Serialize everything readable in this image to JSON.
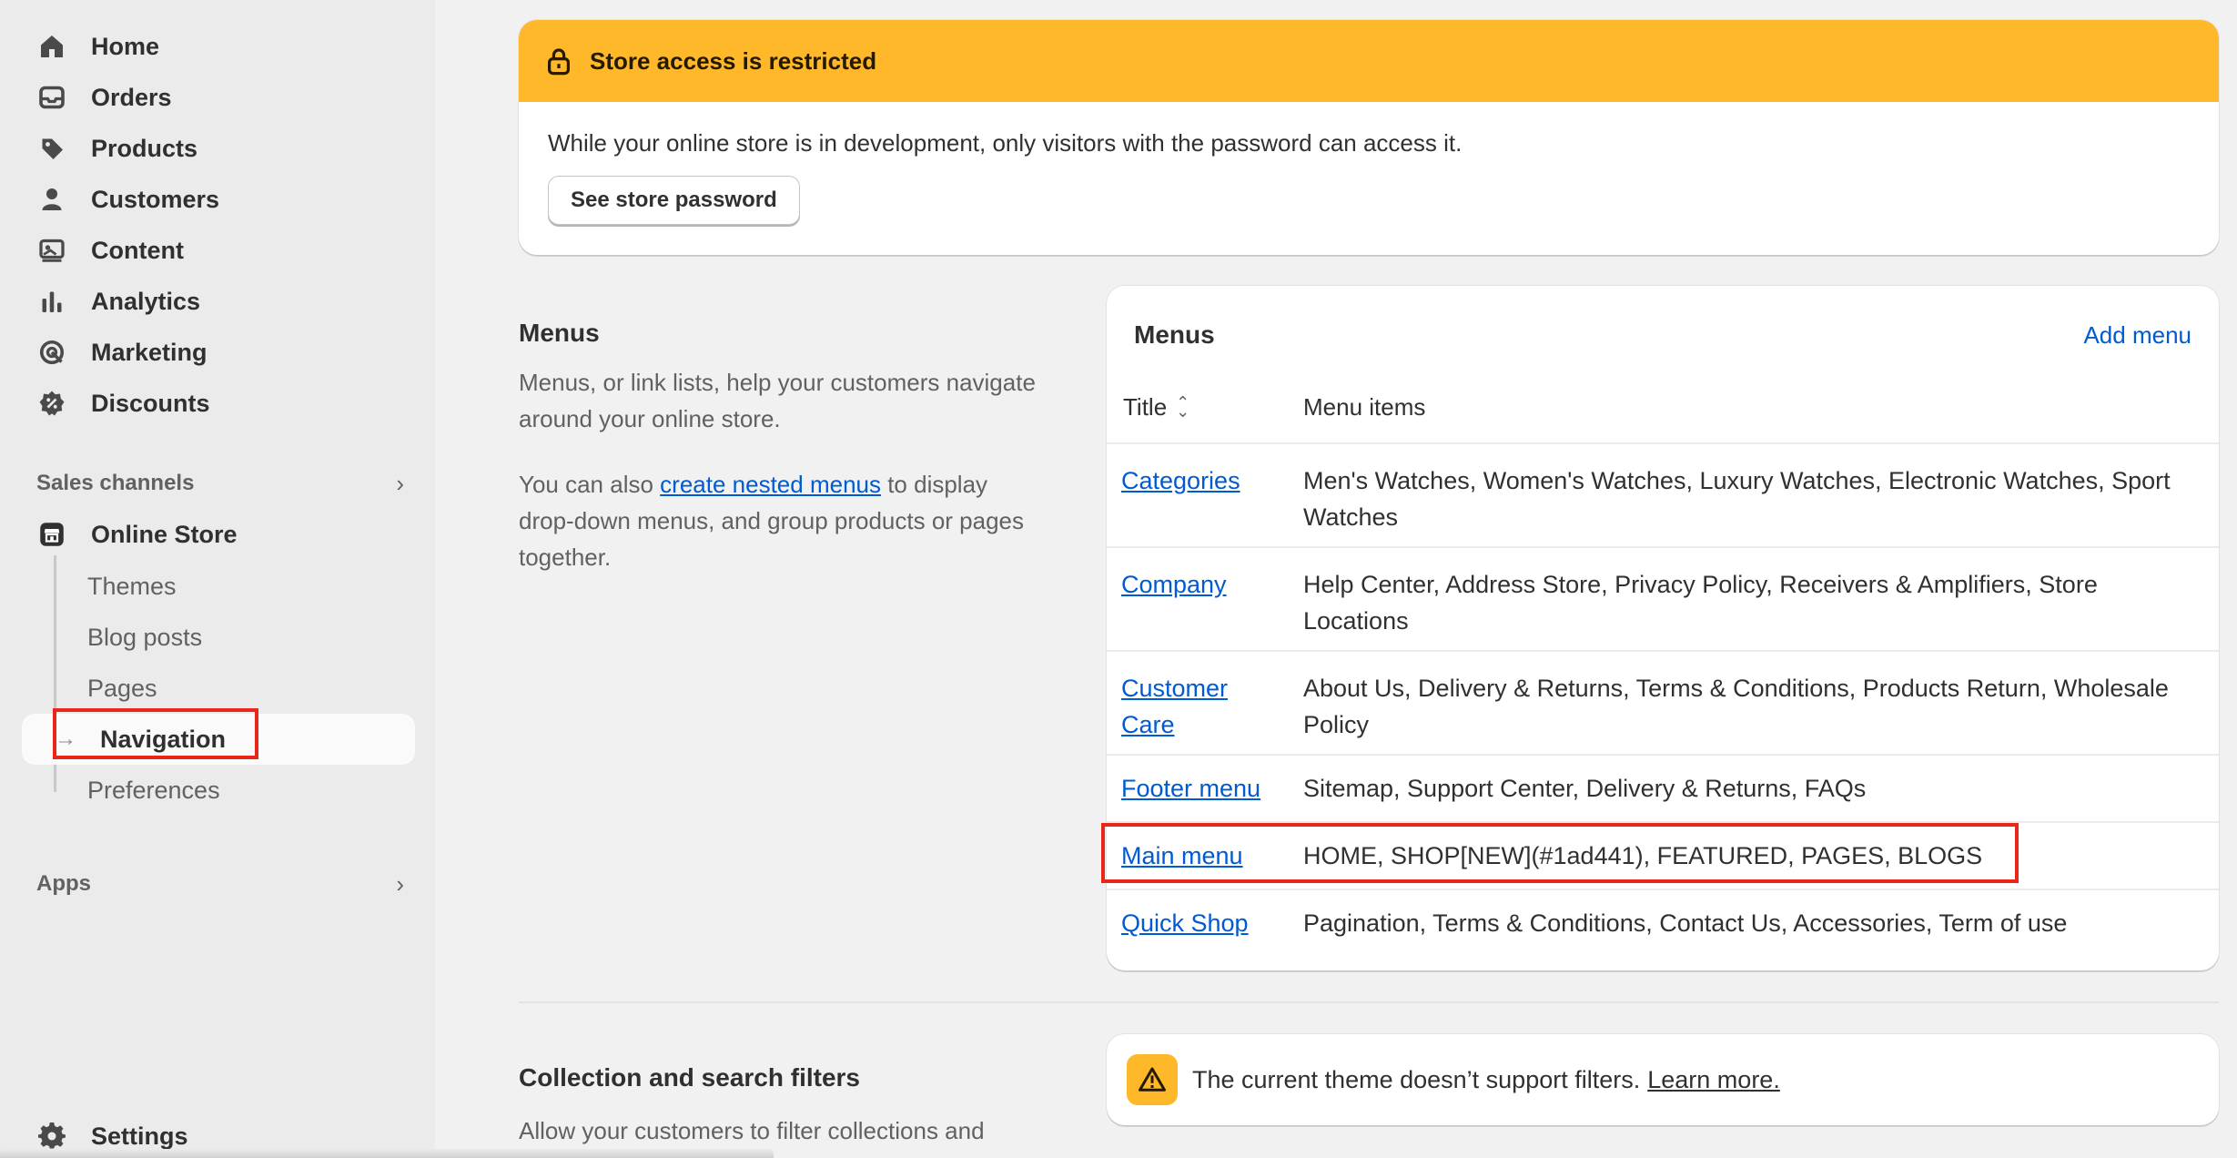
{
  "sidebar": {
    "items": [
      {
        "label": "Home",
        "icon": "home-icon"
      },
      {
        "label": "Orders",
        "icon": "inbox-icon"
      },
      {
        "label": "Products",
        "icon": "tag-icon"
      },
      {
        "label": "Customers",
        "icon": "person-icon"
      },
      {
        "label": "Content",
        "icon": "image-icon"
      },
      {
        "label": "Analytics",
        "icon": "bar-chart-icon"
      },
      {
        "label": "Marketing",
        "icon": "target-icon"
      },
      {
        "label": "Discounts",
        "icon": "discount-icon"
      }
    ],
    "sales_channels_label": "Sales channels",
    "online_store_label": "Online Store",
    "online_store_sub": [
      "Themes",
      "Blog posts",
      "Pages",
      "Navigation",
      "Preferences"
    ],
    "apps_label": "Apps",
    "settings_label": "Settings"
  },
  "banner": {
    "title": "Store access is restricted",
    "body": "While your online store is in development, only visitors with the password can access it.",
    "button": "See store password"
  },
  "menus_section": {
    "title": "Menus",
    "desc": "Menus, or link lists, help your customers navigate around your online store.",
    "desc2_before": "You can also ",
    "desc2_link": "create nested menus",
    "desc2_after": " to display drop-down menus, and group products or pages together."
  },
  "menus_card": {
    "title": "Menus",
    "add_label": "Add menu",
    "col_title": "Title",
    "col_items": "Menu items",
    "rows": [
      {
        "title": "Categories",
        "items": "Men's Watches, Women's Watches, Luxury Watches, Electronic Watches, Sport Watches"
      },
      {
        "title": "Company",
        "items": "Help Center, Address Store, Privacy Policy, Receivers & Amplifiers, Store Locations"
      },
      {
        "title": "Customer Care",
        "items": "About Us, Delivery & Returns, Terms & Conditions, Products Return, Wholesale Policy"
      },
      {
        "title": "Footer menu",
        "items": "Sitemap, Support Center, Delivery & Returns, FAQs"
      },
      {
        "title": "Main menu",
        "items": "HOME, SHOP[NEW](#1ad441), FEATURED, PAGES, BLOGS"
      },
      {
        "title": "Quick Shop",
        "items": "Pagination, Terms & Conditions, Contact Us, Accessories, Term of use"
      }
    ]
  },
  "filters_section": {
    "title": "Collection and search filters",
    "desc": "Allow your customers to filter collections and",
    "notice": "The current theme doesn’t support filters.",
    "notice_link": "Learn more."
  },
  "colors": {
    "accent": "#005bd3",
    "warning": "#ffb829",
    "highlight": "#e8261a"
  }
}
